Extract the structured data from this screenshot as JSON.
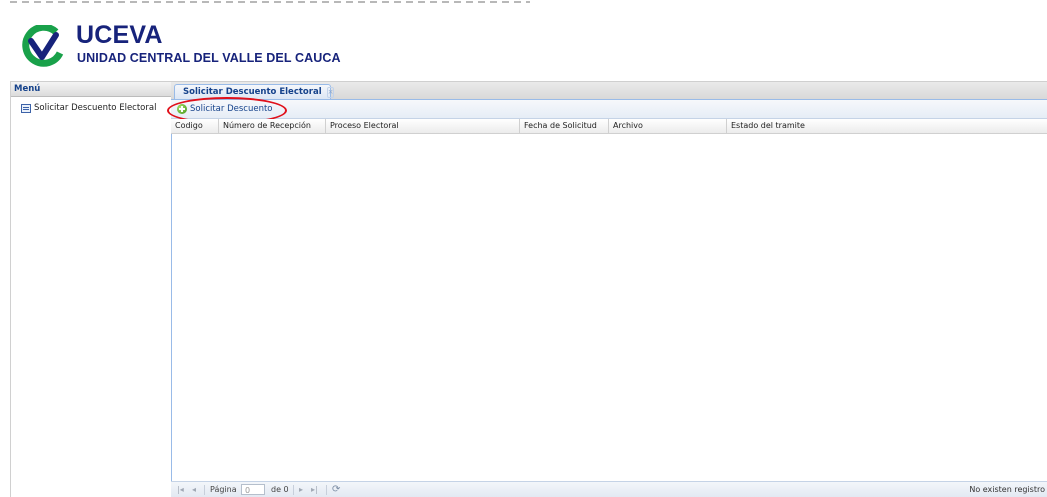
{
  "header": {
    "title": "UCEVA",
    "subtitle": "UNIDAD CENTRAL DEL VALLE DEL CAUCA"
  },
  "menu": {
    "title": "Menú",
    "items": [
      {
        "label": "Solicitar Descuento Electoral",
        "icon": "document-list-icon"
      }
    ]
  },
  "tabs": [
    {
      "label": "Solicitar Descuento Electoral",
      "closable": true
    }
  ],
  "toolbar": {
    "add_button_label": "Solicitar Descuento"
  },
  "grid": {
    "columns": [
      "Codigo",
      "Número de Recepción",
      "Proceso Electoral",
      "Fecha de Solicitud",
      "Archivo",
      "Estado del tramite"
    ],
    "rows": []
  },
  "paging": {
    "page_label": "Página",
    "page_value": "0",
    "of_label": "de 0",
    "status": "No existen registro"
  },
  "colors": {
    "brand": "#17237b",
    "logo_green": "#19a14a",
    "panel_border": "#99bbe8",
    "highlight": "#e0101a"
  }
}
